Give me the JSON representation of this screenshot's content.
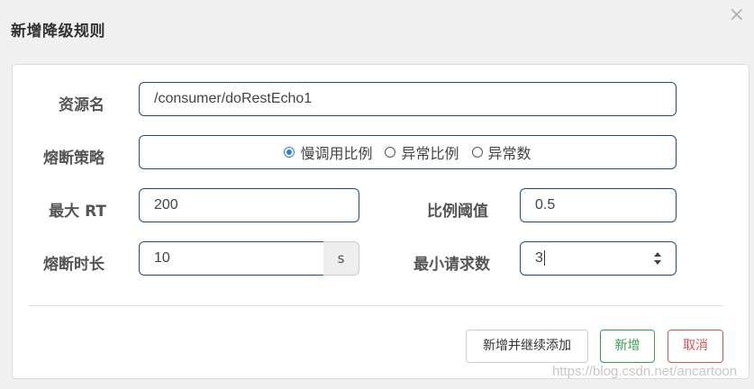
{
  "dialog": {
    "title": "新增降级规则",
    "close_glyph": "×"
  },
  "form": {
    "resource": {
      "label": "资源名",
      "value": "/consumer/doRestEcho1"
    },
    "strategy": {
      "label": "熔断策略",
      "options": [
        "慢调用比例",
        "异常比例",
        "异常数"
      ],
      "selected": "慢调用比例"
    },
    "max_rt": {
      "label": "最大 RT",
      "value": "200"
    },
    "ratio_threshold": {
      "label": "比例阈值",
      "value": "0.5"
    },
    "break_duration": {
      "label": "熔断时长",
      "value": "10",
      "unit": "s"
    },
    "min_requests": {
      "label": "最小请求数",
      "value": "3"
    }
  },
  "buttons": {
    "add_continue": "新增并继续添加",
    "add": "新增",
    "cancel": "取消"
  },
  "watermark": "https://blog.csdn.net/ancartoon",
  "colors": {
    "input_border": "#1f4e79",
    "radio_accent": "#2b7de9",
    "add_button": "#3a9b55",
    "cancel_button": "#d9534f"
  }
}
